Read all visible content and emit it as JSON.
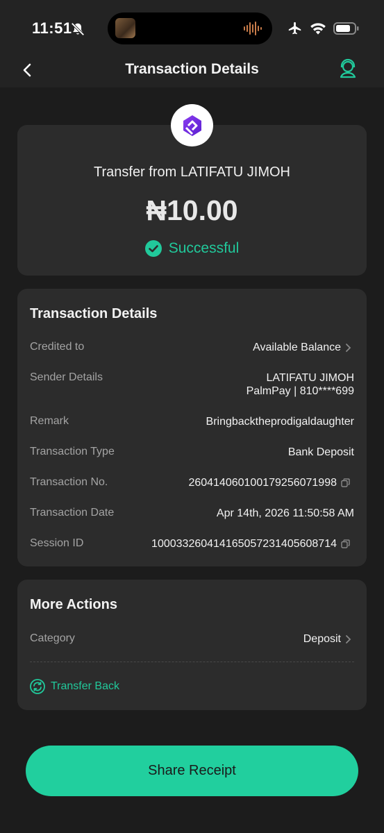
{
  "status_bar": {
    "time": "11:51"
  },
  "header": {
    "title": "Transaction Details"
  },
  "summary": {
    "transfer_from": "Transfer from LATIFATU JIMOH",
    "amount": "₦10.00",
    "status": "Successful"
  },
  "details": {
    "title": "Transaction Details",
    "rows": [
      {
        "label": "Credited to",
        "value": "Available Balance"
      },
      {
        "label": "Sender Details",
        "value": "LATIFATU JIMOH",
        "value2": "PalmPay | 810****699"
      },
      {
        "label": "Remark",
        "value": "Bringbacktheprodigaldaughter"
      },
      {
        "label": "Transaction Type",
        "value": "Bank Deposit"
      },
      {
        "label": "Transaction No.",
        "value": "260414060100179256071998"
      },
      {
        "label": "Transaction Date",
        "value": "Apr 14th, 2026 11:50:58 AM"
      },
      {
        "label": "Session ID",
        "value": "100033260414165057231405608714"
      }
    ]
  },
  "actions": {
    "title": "More Actions",
    "category_label": "Category",
    "category_value": "Deposit",
    "transfer_back": "Transfer Back"
  },
  "share_button": "Share Receipt",
  "colors": {
    "accent": "#21c99b",
    "background": "#1c1c1c",
    "card": "#2c2c2c"
  }
}
